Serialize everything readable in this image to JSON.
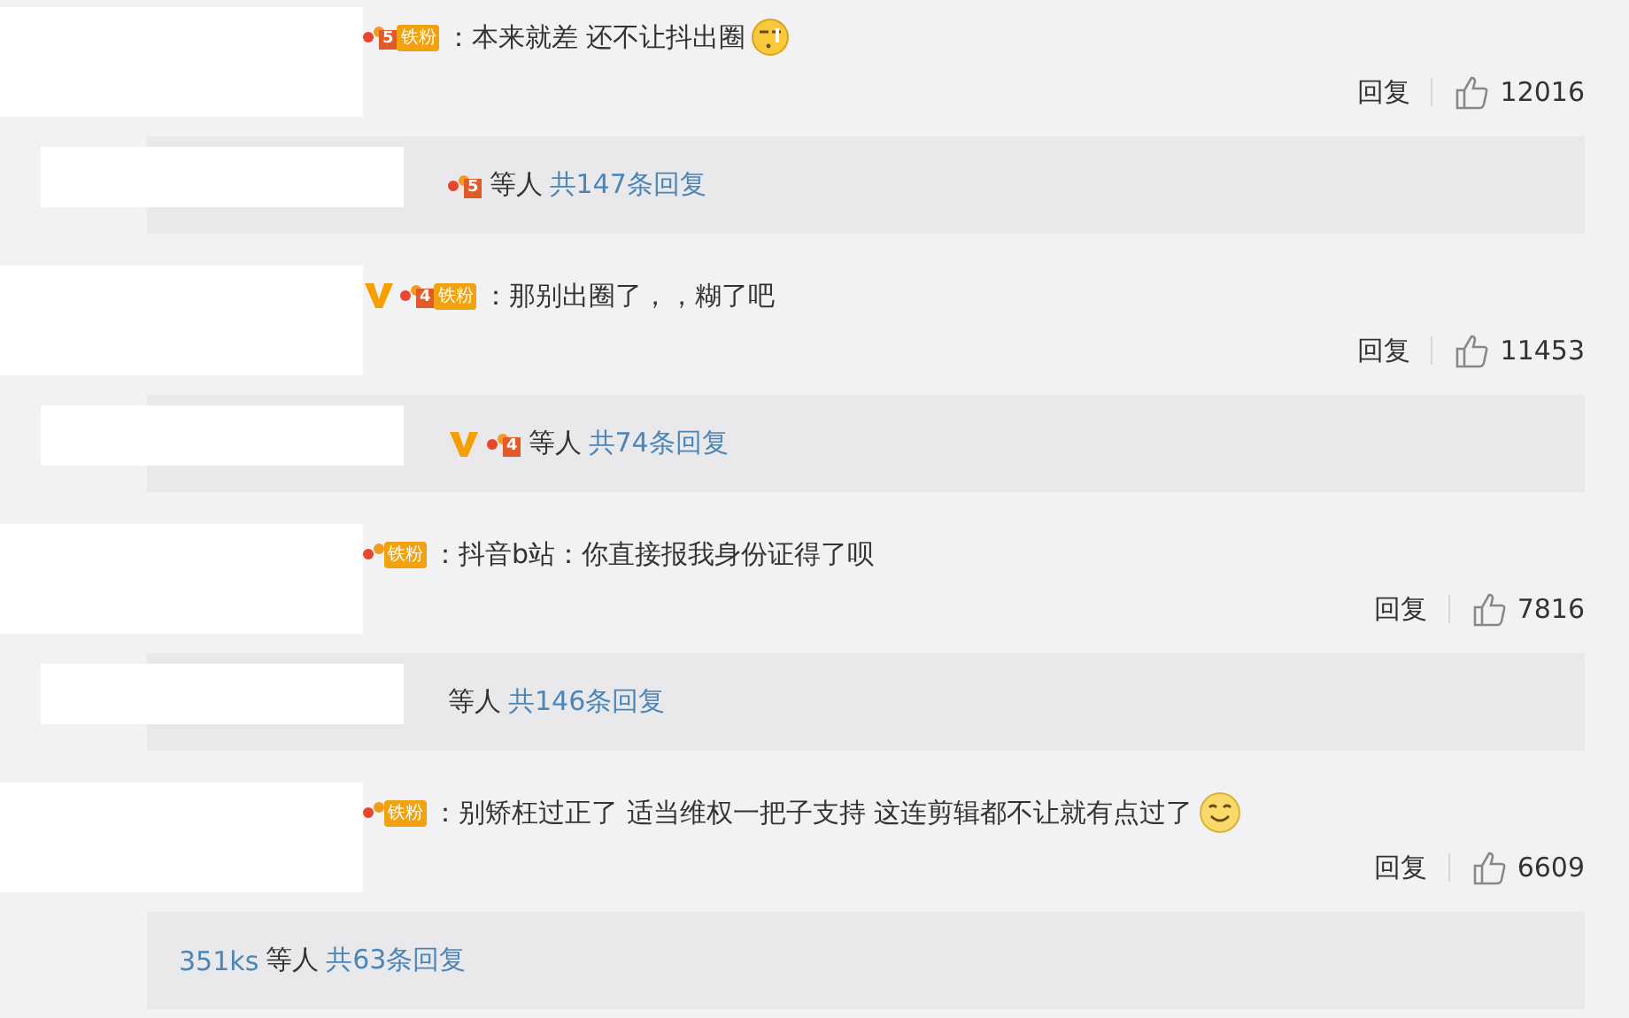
{
  "comments": [
    {
      "verified": false,
      "badge": {
        "level": "5",
        "label": "铁粉"
      },
      "text": "：本来就差 还不让抖出圈",
      "emoji": {
        "kind": "squint"
      },
      "reply_label": "回复",
      "likes": "12016",
      "reply_summary": {
        "verified": false,
        "badge": {
          "level": "5"
        },
        "others": "等人",
        "count": "共147条回复"
      }
    },
    {
      "verified": true,
      "badge": {
        "level": "4",
        "label": "铁粉"
      },
      "text": "：那别出圈了，，糊了吧",
      "reply_label": "回复",
      "likes": "11453",
      "reply_summary": {
        "verified": true,
        "badge": {
          "level": "4"
        },
        "others": "等人",
        "count": "共74条回复"
      }
    },
    {
      "verified": false,
      "badge": {
        "label": "铁粉"
      },
      "text": "：抖音b站：你直接报我身份证得了呗",
      "reply_label": "回复",
      "likes": "7816",
      "reply_summary": {
        "verified": false,
        "others": "等人",
        "count": "共146条回复"
      }
    },
    {
      "verified": false,
      "badge": {
        "label": "铁粉"
      },
      "text": "：别矫枉过正了 适当维权一把子支持 这连剪辑都不让就有点过了",
      "emoji": {
        "kind": "smile"
      },
      "reply_label": "回复",
      "likes": "6609",
      "reply_summary": {
        "verified": false,
        "name": "351ks",
        "others": "等人",
        "count": "共63条回复"
      }
    }
  ]
}
